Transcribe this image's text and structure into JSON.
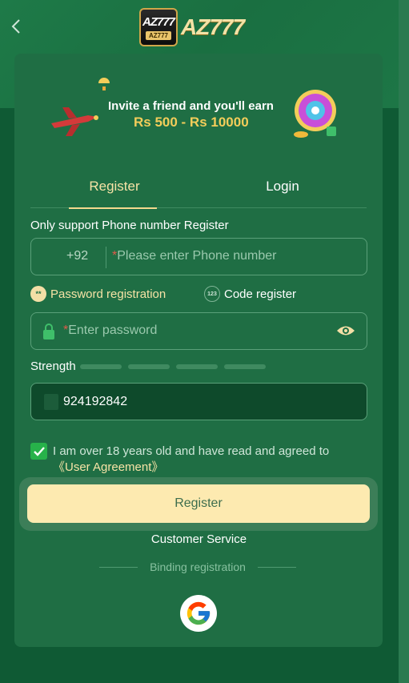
{
  "header": {
    "logo_badge_text": "AZ777",
    "logo_badge_subtext": "AZ777",
    "logo_text": "AZ777"
  },
  "banner": {
    "line1": "Invite a friend and you'll earn",
    "line2": "Rs 500 - Rs 10000"
  },
  "tabs": [
    {
      "label": "Register",
      "active": true
    },
    {
      "label": "Login",
      "active": false
    }
  ],
  "support_note": "Only support Phone number Register",
  "phone": {
    "country_code": "+92",
    "required_mark": "*",
    "placeholder": "Please enter Phone number"
  },
  "registration_modes": [
    {
      "label": "Password registration",
      "icon": "**",
      "selected": true
    },
    {
      "label": "Code register",
      "icon": "123",
      "selected": false
    }
  ],
  "password": {
    "required_mark": "*",
    "placeholder": "Enter password"
  },
  "strength": {
    "label": "Strength",
    "level": 0,
    "segments": 4
  },
  "invite_code": {
    "value": "924192842"
  },
  "agreement": {
    "checked": true,
    "text": "I am over 18 years old and have read and agreed to ",
    "link": "《User Agreement》"
  },
  "register_button": "Register",
  "customer_service": "Customer Service",
  "binding_registration": "Binding registration",
  "colors": {
    "accent": "#f6e3a6",
    "card": "#1f6e44",
    "background": "#0f5a34",
    "button": "#fdeab0",
    "checkbox": "#27b24a"
  },
  "icons": {
    "back": "chevron-left-icon",
    "lock": "lock-icon",
    "eye": "eye-icon",
    "check": "check-icon",
    "google": "google-icon"
  }
}
